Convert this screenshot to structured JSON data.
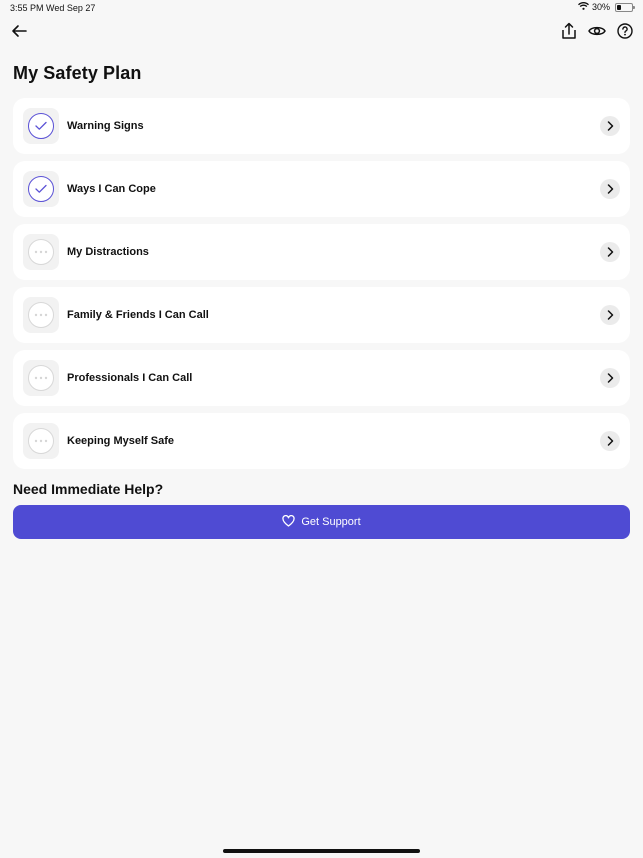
{
  "status_bar": {
    "time": "3:55 PM",
    "date": "Wed Sep 27",
    "battery_percent": "30%",
    "battery_level": 0.3
  },
  "nav": {
    "back_icon": "arrow-left-icon",
    "actions": [
      "share-icon",
      "eye-icon",
      "help-circle-icon"
    ]
  },
  "page_title": "My Safety Plan",
  "plan_items": [
    {
      "label": "Warning Signs",
      "status": "done"
    },
    {
      "label": "Ways I Can Cope",
      "status": "done"
    },
    {
      "label": "My Distractions",
      "status": "todo"
    },
    {
      "label": "Family & Friends I Can Call",
      "status": "todo"
    },
    {
      "label": "Professionals I Can Call",
      "status": "todo"
    },
    {
      "label": "Keeping Myself Safe",
      "status": "todo"
    }
  ],
  "help": {
    "heading": "Need Immediate Help?",
    "button_label": "Get Support",
    "button_icon": "heart-icon"
  },
  "colors": {
    "accent": "#4f4bd3",
    "check": "#5b52d6",
    "background": "#f7f7f7"
  }
}
